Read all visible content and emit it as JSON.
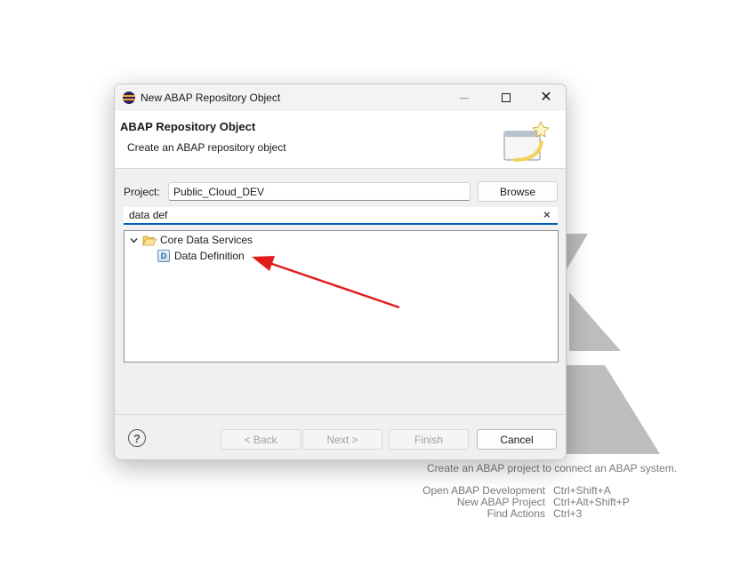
{
  "dialog": {
    "title": "New ABAP Repository Object",
    "header_title": "ABAP Repository Object",
    "header_subtitle": "Create an ABAP repository object",
    "project_label": "Project:",
    "project_value": "Public_Cloud_DEV",
    "browse_label": "Browse",
    "filter_value": "data def",
    "filter_clear_glyph": "×",
    "close_glyph": "✕",
    "tree": [
      {
        "label": "Core Data Services",
        "expanded": true,
        "icon": "folder-open-icon"
      },
      {
        "label": "Data Definition",
        "icon": "data-definition-icon"
      }
    ],
    "buttons": {
      "help_glyph": "?",
      "back": "< Back",
      "next": "Next >",
      "finish": "Finish",
      "cancel": "Cancel"
    }
  },
  "background": {
    "intro": "Create an ABAP project to connect an ABAP system.",
    "actions": [
      {
        "label": "Open ABAP Development",
        "shortcut": "Ctrl+Shift+A"
      },
      {
        "label": "New ABAP Project",
        "shortcut": "Ctrl+Alt+Shift+P"
      },
      {
        "label": "Find Actions",
        "shortcut": "Ctrl+3"
      }
    ]
  },
  "colors": {
    "accent": "#005fb8",
    "annotation": "#e31b1b",
    "dialog_bg": "#f0f0f0"
  }
}
